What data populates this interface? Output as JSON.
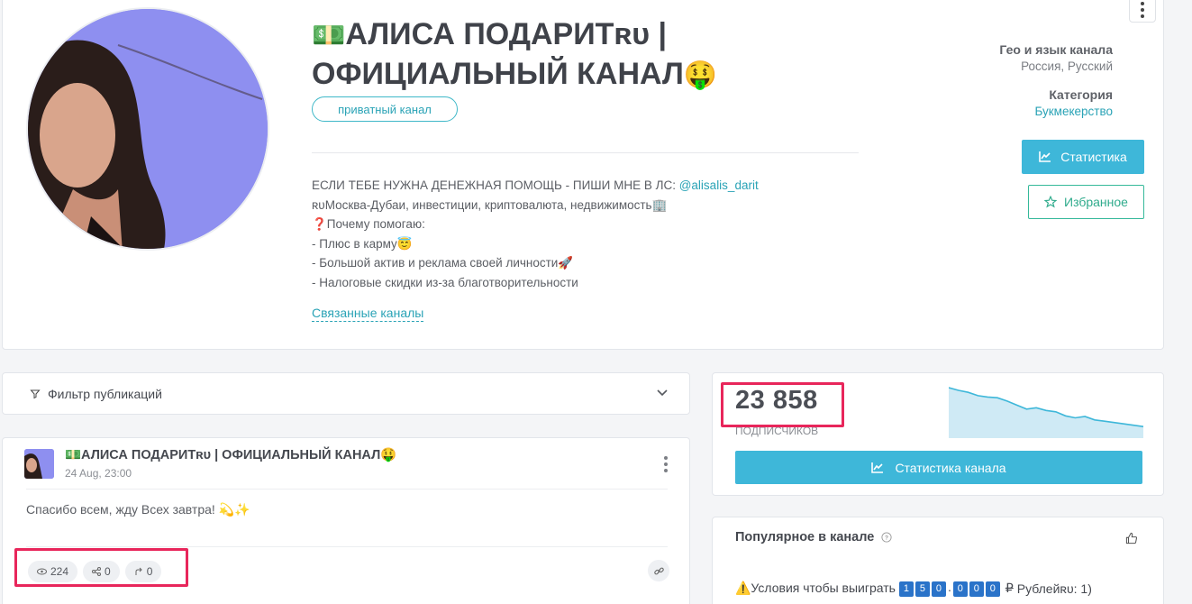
{
  "channel": {
    "title_emoji_prefix": "💵",
    "title": "АЛИСА ПОДАРИТʀᴜ | ОФИЦИАЛЬНЫЙ КАНАЛ",
    "title_emoji_suffix": "🤑",
    "private_label": "приватный канал",
    "description": {
      "line1_text": "ЕСЛИ ТЕБЕ НУЖНА ДЕНЕЖНАЯ ПОМОЩЬ - ПИШИ МНЕ В ЛС: ",
      "line1_link": "@alisalis_darit",
      "line2": "ʀᴜМосква-Дубаи, инвестиции, криптовалюта, недвижимость🏢",
      "line3": "❓Почему помогаю:",
      "line4": "- Плюс в карму😇",
      "line5": "- Большой актив и реклама своей личности🚀",
      "line6": "- Налоговые скидки из-за благотворительности"
    },
    "related_link": "Связанные каналы",
    "geo_label": "Гео и язык канала",
    "geo_value": "Россия, Русский",
    "category_label": "Категория",
    "category_value": "Букмекерство",
    "stats_button": "Статистика",
    "favorite_button": "Избранное"
  },
  "filter": {
    "label": "Фильтр публикаций"
  },
  "post": {
    "title": "💵АЛИСА ПОДАРИТʀᴜ | ОФИЦИАЛЬНЫЙ КАНАЛ🤑",
    "date": "24 Aug, 23:00",
    "text": "Спасибо всем, жду Всех завтра! 💫✨",
    "views": "224",
    "shares": "0",
    "forwards": "0"
  },
  "subscribers": {
    "count": "23 858",
    "label": "подписчиков",
    "button": "Статистика канала",
    "trend": [
      100,
      96,
      93,
      88,
      86,
      85,
      80,
      74,
      68,
      70,
      66,
      64,
      58,
      55,
      57,
      52,
      50,
      48,
      46,
      44,
      42
    ]
  },
  "popular": {
    "title": "Популярное в канале",
    "item_prefix": "⚠️Условия чтобы выиграть ",
    "digits": [
      "1",
      "5",
      "0",
      ".",
      "0",
      "0",
      "0"
    ],
    "item_currency": "₽",
    "item_suffix": "Рублейʀᴜ: 1)"
  },
  "colors": {
    "accent": "#3eb7d9",
    "favorite": "#35b99a",
    "highlight": "#e8265b",
    "link": "#2aa3b6"
  }
}
